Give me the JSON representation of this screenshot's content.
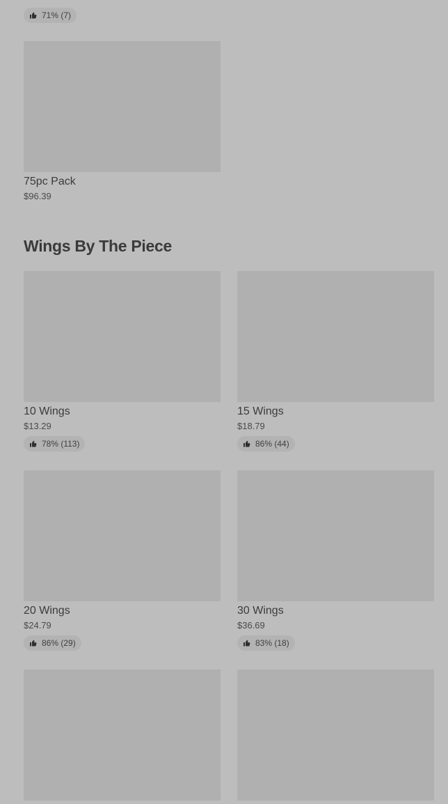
{
  "colors": {
    "background": "#bdbdbd",
    "image_placeholder": "#b0b0b0",
    "badge_background": "#b3b3b3",
    "text": "#3a3a3a"
  },
  "top_cards": {
    "left_rating": "71% (7)",
    "item_75pc": {
      "title": "75pc Pack",
      "price": "$96.39"
    }
  },
  "section": {
    "title": "Wings By The Piece"
  },
  "items": [
    {
      "title": "10 Wings",
      "price": "$13.29",
      "rating": "78% (113)",
      "icon": "thumbs-up-icon"
    },
    {
      "title": "15 Wings",
      "price": "$18.79",
      "rating": "86% (44)",
      "icon": "thumbs-up-icon"
    },
    {
      "title": "20 Wings",
      "price": "$24.79",
      "rating": "86% (29)",
      "icon": "thumbs-up-icon"
    },
    {
      "title": "30 Wings",
      "price": "$36.69",
      "rating": "83% (18)",
      "icon": "thumbs-up-icon"
    }
  ]
}
